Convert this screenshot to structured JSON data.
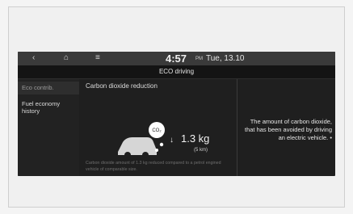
{
  "status": {
    "back_icon": "back-chevron-icon",
    "home_icon": "home-icon",
    "menu_icon": "menu-icon",
    "time": "4:57",
    "ampm": "PM",
    "date": "Tue, 13.10"
  },
  "header": {
    "title": "ECO driving"
  },
  "sidebar": {
    "items": [
      {
        "label": "Eco contrib."
      },
      {
        "label": "Fuel economy history"
      }
    ]
  },
  "main": {
    "section_title": "Carbon dioxide reduction",
    "co2_label": "CO₂",
    "value": "1.3 kg",
    "per": "(5 km)",
    "description": "Carbon dioxide amount of 1.3 kg reduced compared to a petrol engined vehicle of comparable size."
  },
  "note": {
    "text": "The amount of carbon dioxide, that has been avoided by driving an electric vehicle.",
    "bullet": "•"
  },
  "colors": {
    "screen_bg": "#1f1f1f",
    "statusbar_bg": "#3a3a3a",
    "text_primary": "#e8e8e8"
  }
}
